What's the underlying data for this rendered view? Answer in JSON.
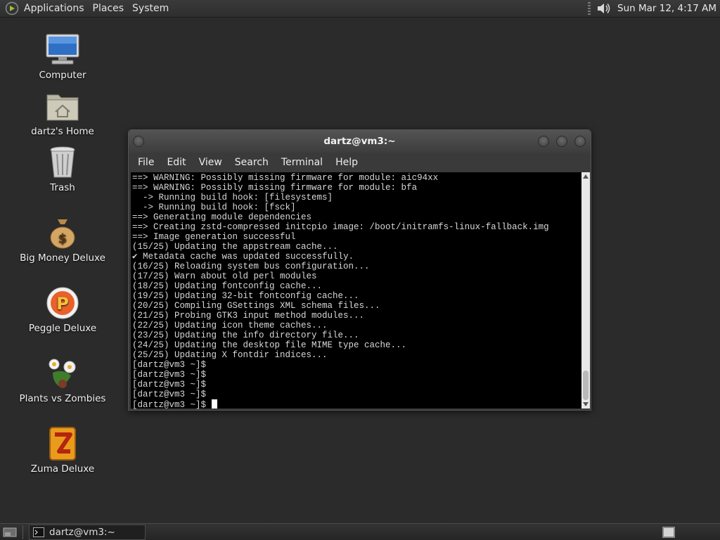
{
  "top_panel": {
    "menus": [
      "Applications",
      "Places",
      "System"
    ],
    "clock": "Sun Mar 12,  4:17 AM"
  },
  "desktop_icons": [
    {
      "label": "Computer",
      "icon": "computer-icon"
    },
    {
      "label": "dartz's Home",
      "icon": "home-folder-icon"
    },
    {
      "label": "Trash",
      "icon": "trash-icon"
    },
    {
      "label": "Big Money Deluxe",
      "icon": "money-bag-icon"
    },
    {
      "label": "Peggle Deluxe",
      "icon": "peggle-icon"
    },
    {
      "label": "Plants vs Zombies",
      "icon": "plants-vs-zombies-icon"
    },
    {
      "label": "Zuma Deluxe",
      "icon": "zuma-icon"
    }
  ],
  "terminal": {
    "title": "dartz@vm3:~",
    "menus": [
      "File",
      "Edit",
      "View",
      "Search",
      "Terminal",
      "Help"
    ],
    "lines": [
      "==> WARNING: Possibly missing firmware for module: aic94xx",
      "==> WARNING: Possibly missing firmware for module: bfa",
      "  -> Running build hook: [filesystems]",
      "  -> Running build hook: [fsck]",
      "==> Generating module dependencies",
      "==> Creating zstd-compressed initcpio image: /boot/initramfs-linux-fallback.img",
      "==> Image generation successful",
      "(15/25) Updating the appstream cache...",
      "✔ Metadata cache was updated successfully.",
      "(16/25) Reloading system bus configuration...",
      "(17/25) Warn about old perl modules",
      "(18/25) Updating fontconfig cache...",
      "(19/25) Updating 32-bit fontconfig cache...",
      "(20/25) Compiling GSettings XML schema files...",
      "(21/25) Probing GTK3 input method modules...",
      "(22/25) Updating icon theme caches...",
      "(23/25) Updating the info directory file...",
      "(24/25) Updating the desktop file MIME type cache...",
      "(25/25) Updating X fontdir indices...",
      "[dartz@vm3 ~]$",
      "[dartz@vm3 ~]$",
      "[dartz@vm3 ~]$",
      "[dartz@vm3 ~]$"
    ],
    "prompt": "[dartz@vm3 ~]$"
  },
  "bottom_panel": {
    "task_label": "dartz@vm3:~"
  },
  "colors": {
    "desktop_bg": "#2b2b2b",
    "terminal_bg": "#000000",
    "terminal_fg": "#d8d8d8"
  }
}
